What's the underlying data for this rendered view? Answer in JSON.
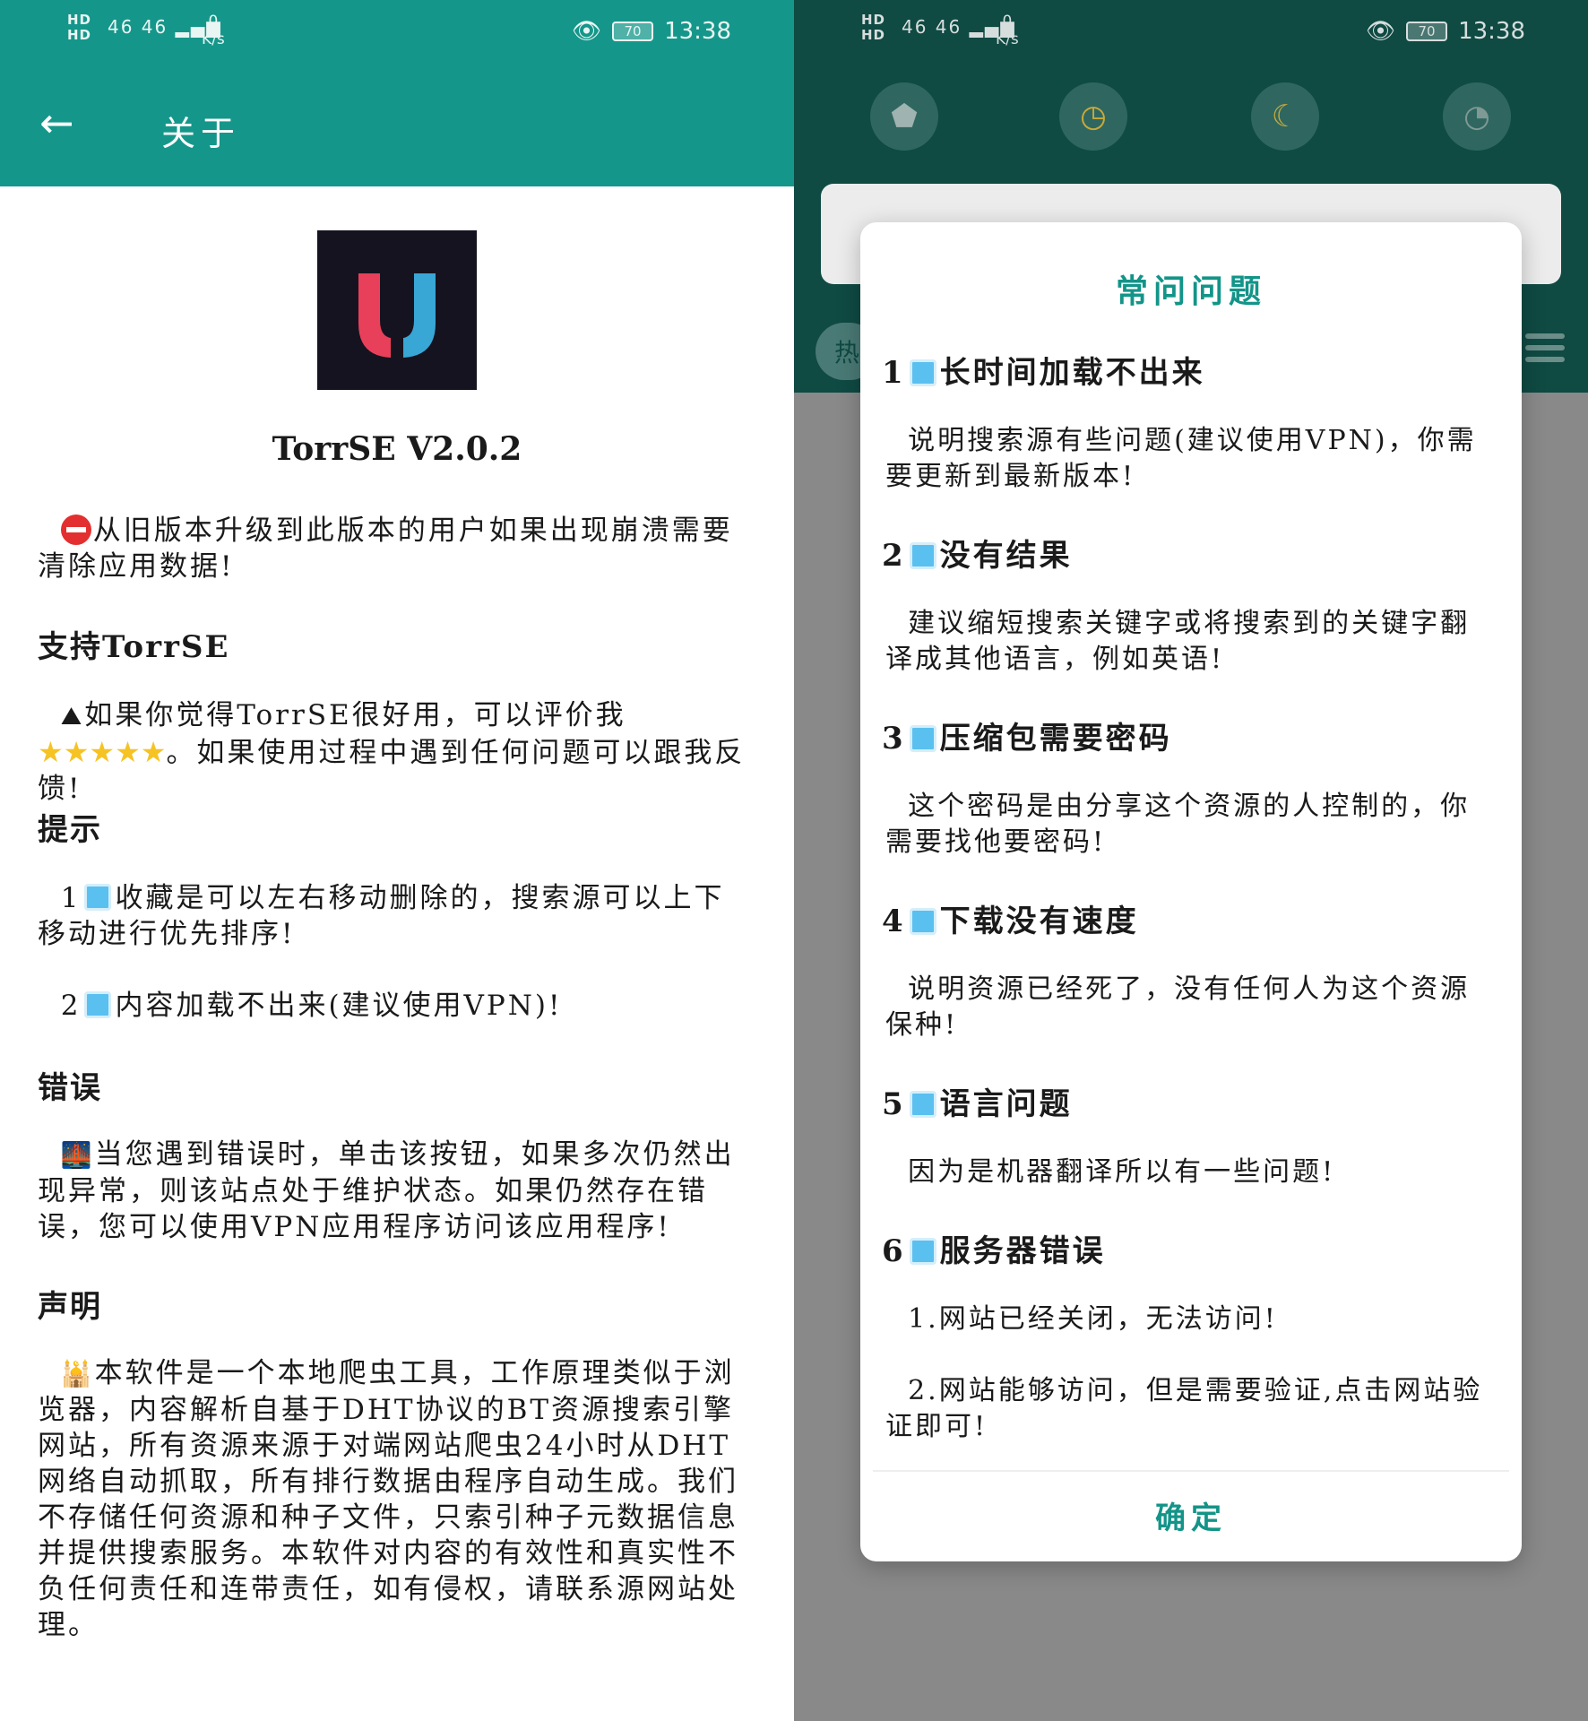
{
  "status_bar": {
    "sig_top": "HD",
    "sig_bottom": "HD",
    "network": "46  46",
    "speed_value": "0",
    "speed_unit": "K/s",
    "battery": "70",
    "time": "13:38"
  },
  "about_screen": {
    "back_icon": "arrow-left-icon",
    "title": "关于",
    "app_name_version": "TorrSE  V2.0.2",
    "warning_text": "从旧版本升级到此版本的用户如果出现崩溃需要清除应用数据!",
    "support_heading": "支持TorrSE",
    "support_text_a": "如果你觉得TorrSE很好用，可以评价我",
    "support_text_b": "。如果使用过程中遇到任何问题可以跟我反馈!",
    "tips_heading": "提示",
    "tip1_num": "1",
    "tip1_text": "收藏是可以左右移动删除的，搜索源可以上下移动进行优先排序!",
    "tip2_num": "2",
    "tip2_text": "内容加载不出来(建议使用VPN)!",
    "error_heading": "错误",
    "error_text": "当您遇到错误时，单击该按钮，如果多次仍然出现异常，则该站点处于维护状态。如果仍然存在错误，您可以使用VPN应用程序访问该应用程序!",
    "statement_heading": "声明",
    "statement_text": "本软件是一个本地爬虫工具，工作原理类似于浏览器，内容解析自基于DHT协议的BT资源搜索引擎网站，所有资源来源于对端网站爬虫24小时从DHT网络自动抓取，所有排行数据由程序自动生成。我们不存储任何资源和种子文件，只索引种子元数据信息并提供搜索服务。本软件对内容的有效性和真实性不负任何责任和连带责任，如有侵权，请联系源网站处理。"
  },
  "main_screen": {
    "nav_icons": [
      "badge-icon",
      "clock-icon",
      "moon-cloud-icon",
      "rss-icon"
    ],
    "tab_label": "热"
  },
  "faq_dialog": {
    "title": "常问问题",
    "items": [
      {
        "num": "1",
        "title": "长时间加载不出来",
        "text": "说明搜索源有些问题(建议使用VPN)，你需要更新到最新版本!"
      },
      {
        "num": "2",
        "title": "没有结果",
        "text": "建议缩短搜索关键字或将搜索到的关键字翻译成其他语言，例如英语!"
      },
      {
        "num": "3",
        "title": "压缩包需要密码",
        "text": "这个密码是由分享这个资源的人控制的，你需要找他要密码!"
      },
      {
        "num": "4",
        "title": "下载没有速度",
        "text": "说明资源已经死了，没有任何人为这个资源保种!"
      },
      {
        "num": "5",
        "title": "语言问题",
        "text": "因为是机器翻译所以有一些问题!"
      },
      {
        "num": "6",
        "title": "服务器错误",
        "text": "1.网站已经关闭，无法访问!",
        "text2": "2.网站能够访问，但是需要验证,点击网站验证即可!"
      }
    ],
    "ok_label": "确定"
  },
  "colors": {
    "teal": "#14978a",
    "dark_teal": "#0f4a43",
    "accent": "#139488",
    "logo_red": "#e8405a",
    "logo_blue": "#38a7d6"
  }
}
